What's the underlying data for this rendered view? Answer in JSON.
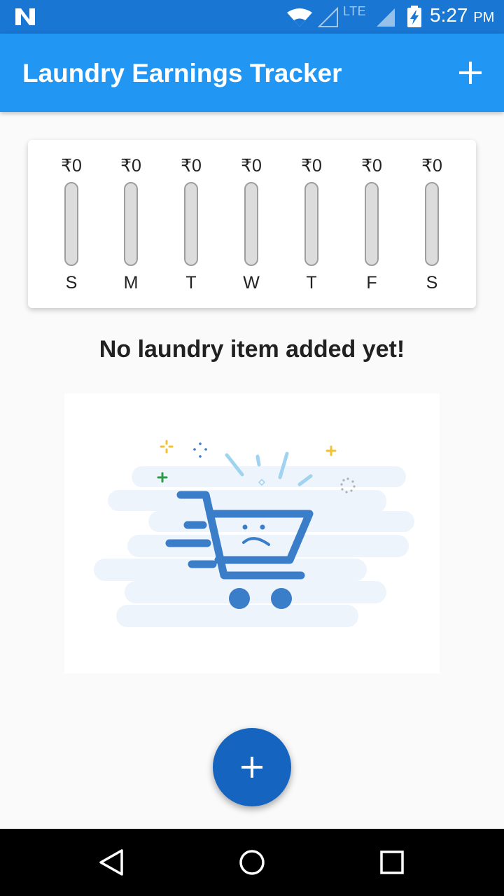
{
  "status_bar": {
    "network_label": "LTE",
    "time": "5:27",
    "ampm": "PM"
  },
  "app_bar": {
    "title": "Laundry Earnings Tracker",
    "action_icon": "plus-icon"
  },
  "week": {
    "days": [
      {
        "day": "S",
        "amount": "₹0",
        "fill": 0
      },
      {
        "day": "M",
        "amount": "₹0",
        "fill": 0
      },
      {
        "day": "T",
        "amount": "₹0",
        "fill": 0
      },
      {
        "day": "W",
        "amount": "₹0",
        "fill": 0
      },
      {
        "day": "T",
        "amount": "₹0",
        "fill": 0
      },
      {
        "day": "F",
        "amount": "₹0",
        "fill": 0
      },
      {
        "day": "S",
        "amount": "₹0",
        "fill": 0
      }
    ]
  },
  "empty_state": {
    "message": "No laundry item added yet!",
    "illustration": "sad-shopping-cart"
  },
  "fab": {
    "icon": "plus-icon"
  },
  "nav": {
    "icons": [
      "back-icon",
      "home-icon",
      "recents-icon"
    ]
  },
  "colors": {
    "status_bar": "#1976d2",
    "app_bar": "#2196f3",
    "fab": "#1565c0",
    "cart": "#3a7dc9"
  }
}
